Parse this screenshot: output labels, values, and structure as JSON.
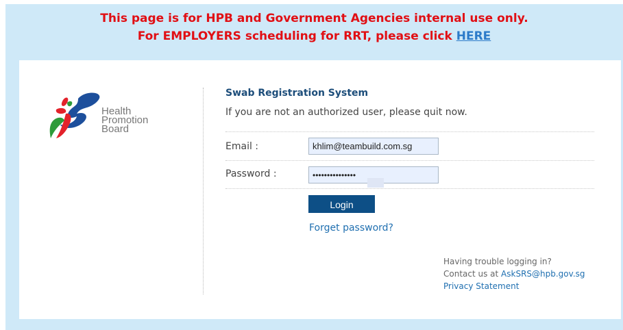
{
  "notice": {
    "line1": "This page is for HPB and Government Agencies internal use only.",
    "line2_prefix": "For EMPLOYERS scheduling for RRT, please click ",
    "line2_link": "HERE"
  },
  "logo": {
    "line1": "Health",
    "line2": "Promotion",
    "line3": "Board"
  },
  "form": {
    "title": "Swab Registration System",
    "subtitle": "If you are not an authorized user, please quit now.",
    "email_label": "Email :",
    "email_value": "khlim@teambuild.com.sg",
    "password_label": "Password :",
    "password_value": "•••••••••••••••",
    "login_label": "Login",
    "forget_label": "Forget password?"
  },
  "help": {
    "trouble": "Having trouble logging in?",
    "contact_prefix": "Contact us at ",
    "contact_email": "AskSRS@hpb.gov.sg",
    "privacy": "Privacy Statement"
  },
  "colors": {
    "notice_red": "#e10f14",
    "frame_blue": "#cfe9f8",
    "button_navy": "#0d4f86",
    "link_blue": "#1f6fb0",
    "title_navy": "#1c4d7a"
  }
}
